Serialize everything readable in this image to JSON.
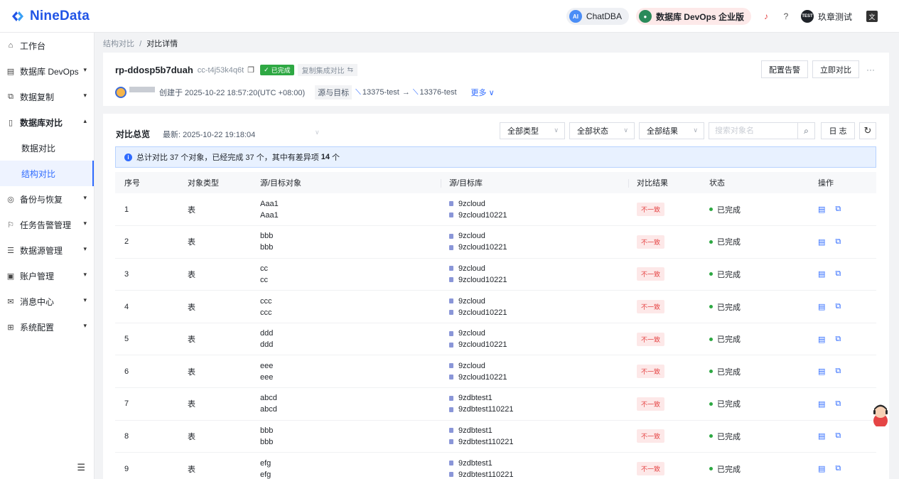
{
  "app": {
    "logo_text": "NineData",
    "brand_color": "#2154e6"
  },
  "topbar": {
    "chatdba_label": "ChatDBA",
    "chatdba_badge": "AI",
    "edition_label": "数据库 DevOps 企业版",
    "user_badge": "TEST",
    "user_name": "玖章测试",
    "icons": [
      "bell-icon",
      "help-icon",
      "translate-icon"
    ]
  },
  "sidebar": {
    "items": [
      {
        "label": "工作台",
        "icon": "home-icon"
      },
      {
        "label": "数据库 DevOps",
        "icon": "devops-icon"
      },
      {
        "label": "数据复制",
        "icon": "replication-icon"
      },
      {
        "label": "数据库对比",
        "icon": "compare-icon"
      },
      {
        "label": "备份与恢复",
        "icon": "backup-icon"
      },
      {
        "label": "任务告警管理",
        "icon": "alert-icon"
      },
      {
        "label": "数据源管理",
        "icon": "datasource-icon"
      },
      {
        "label": "账户管理",
        "icon": "account-icon"
      },
      {
        "label": "消息中心",
        "icon": "message-icon"
      },
      {
        "label": "系统配置",
        "icon": "settings-icon"
      }
    ],
    "subitems": [
      {
        "label": "数据对比"
      },
      {
        "label": "结构对比"
      }
    ]
  },
  "breadcrumb": {
    "parent": "结构对比",
    "separator": "/",
    "current": "对比详情"
  },
  "header": {
    "title": "rp-ddosp5b7duah",
    "id": "cc-t4j53k4q6t",
    "status": "已完成",
    "tag": "复制集成对比",
    "created": "创建于 2025-10-22 18:57:20(UTC +08:00)",
    "src_target_label": "源与目标",
    "source": "13375-test",
    "arrow": "→",
    "target": "13376-test",
    "more": "更多",
    "btn_alert": "配置告警",
    "btn_compare": "立即对比"
  },
  "overview": {
    "title": "对比总览",
    "latest": "最新: 2025-10-22 19:18:04",
    "filter_type": "全部类型",
    "filter_status": "全部状态",
    "filter_result": "全部结果",
    "search_placeholder": "搜索对象名",
    "log_label": "日 志",
    "info_prefix": "总计对比 37 个对象，已经完成 37 个，其中有差异项",
    "info_count": "14",
    "info_suffix": "个"
  },
  "table": {
    "headers": [
      "序号",
      "对象类型",
      "源/目标对象",
      "源/目标库",
      "对比结果",
      "状态",
      "操作"
    ],
    "rows": [
      {
        "no": "1",
        "type": "表",
        "src_obj": "Aaa1",
        "tgt_obj": "Aaa1",
        "src_db": "9zcloud",
        "tgt_db": "9zcloud10221",
        "result": "不一致",
        "status": "已完成"
      },
      {
        "no": "2",
        "type": "表",
        "src_obj": "bbb",
        "tgt_obj": "bbb",
        "src_db": "9zcloud",
        "tgt_db": "9zcloud10221",
        "result": "不一致",
        "status": "已完成"
      },
      {
        "no": "3",
        "type": "表",
        "src_obj": "cc",
        "tgt_obj": "cc",
        "src_db": "9zcloud",
        "tgt_db": "9zcloud10221",
        "result": "不一致",
        "status": "已完成"
      },
      {
        "no": "4",
        "type": "表",
        "src_obj": "ccc",
        "tgt_obj": "ccc",
        "src_db": "9zcloud",
        "tgt_db": "9zcloud10221",
        "result": "不一致",
        "status": "已完成"
      },
      {
        "no": "5",
        "type": "表",
        "src_obj": "ddd",
        "tgt_obj": "ddd",
        "src_db": "9zcloud",
        "tgt_db": "9zcloud10221",
        "result": "不一致",
        "status": "已完成"
      },
      {
        "no": "6",
        "type": "表",
        "src_obj": "eee",
        "tgt_obj": "eee",
        "src_db": "9zcloud",
        "tgt_db": "9zcloud10221",
        "result": "不一致",
        "status": "已完成"
      },
      {
        "no": "7",
        "type": "表",
        "src_obj": "abcd",
        "tgt_obj": "abcd",
        "src_db": "9zdbtest1",
        "tgt_db": "9zdbtest110221",
        "result": "不一致",
        "status": "已完成"
      },
      {
        "no": "8",
        "type": "表",
        "src_obj": "bbb",
        "tgt_obj": "bbb",
        "src_db": "9zdbtest1",
        "tgt_db": "9zdbtest110221",
        "result": "不一致",
        "status": "已完成"
      },
      {
        "no": "9",
        "type": "表",
        "src_obj": "efg",
        "tgt_obj": "efg",
        "src_db": "9zdbtest1",
        "tgt_db": "9zdbtest110221",
        "result": "不一致",
        "status": "已完成"
      }
    ]
  },
  "colors": {
    "accent": "#2f6bff",
    "success": "#2ea843",
    "danger": "#e54545"
  }
}
